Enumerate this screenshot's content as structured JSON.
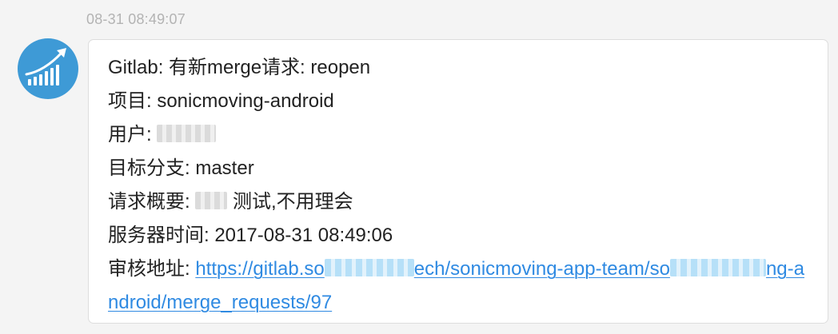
{
  "message": {
    "timestamp": "08-31 08:49:07",
    "avatar_icon": "growth-chart-icon",
    "colors": {
      "avatar_bg": "#3e9ad6",
      "link": "#2f8ae2",
      "timestamp": "#b3b3b3"
    },
    "lines": {
      "title": "Gitlab: 有新merge请求: reopen",
      "project": "项目: sonicmoving-android",
      "user_label": "用户: ",
      "branch": "目标分支: master",
      "summary_label": "请求概要: ",
      "summary_text": " 测试,不用理会",
      "server_time": "服务器时间: 2017-08-31 08:49:06",
      "review_label": "审核地址: "
    },
    "review_link": {
      "part1": "https://gitlab.so",
      "part2": "ech/sonicmoving-app-team/so",
      "part3": "ng-android/merge_requests/97"
    }
  }
}
